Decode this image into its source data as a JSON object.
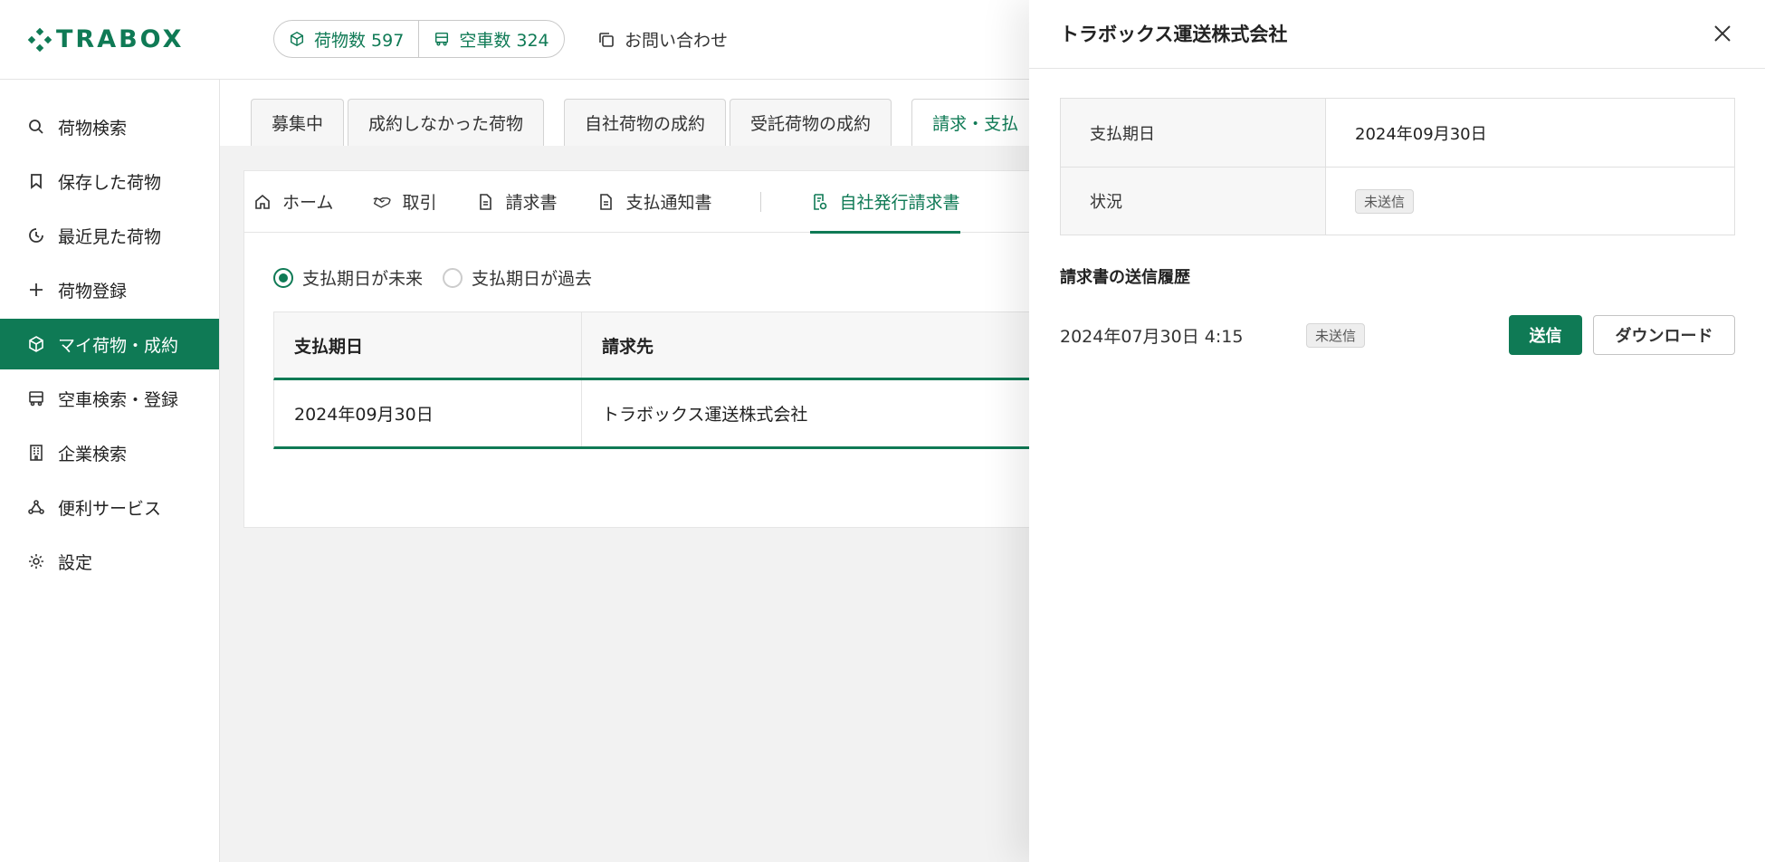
{
  "header": {
    "logo_text": "TRABOX",
    "cargo_count_label": "荷物数 597",
    "truck_count_label": "空車数 324",
    "contact_label": "お問い合わせ"
  },
  "sidebar": {
    "items": [
      {
        "label": "荷物検索",
        "icon": "search-icon"
      },
      {
        "label": "保存した荷物",
        "icon": "bookmark-icon"
      },
      {
        "label": "最近見た荷物",
        "icon": "history-icon"
      },
      {
        "label": "荷物登録",
        "icon": "plus-icon"
      },
      {
        "label": "マイ荷物・成約",
        "icon": "box-icon",
        "active": true
      },
      {
        "label": "空車検索・登録",
        "icon": "truck-icon"
      },
      {
        "label": "企業検索",
        "icon": "building-icon"
      },
      {
        "label": "便利サービス",
        "icon": "network-icon"
      },
      {
        "label": "設定",
        "icon": "gear-icon"
      }
    ]
  },
  "tabs": [
    "募集中",
    "成約しなかった荷物",
    "自社荷物の成約",
    "受託荷物の成約",
    "請求・支払"
  ],
  "subnav": [
    "ホーム",
    "取引",
    "請求書",
    "支払通知書",
    "自社発行請求書"
  ],
  "filter": {
    "future_label": "支払期日が未来",
    "past_label": "支払期日が過去"
  },
  "table": {
    "headers": [
      "支払期日",
      "請求先"
    ],
    "rows": [
      [
        "2024年09月30日",
        "トラボックス運送株式会社"
      ]
    ]
  },
  "drawer": {
    "title": "トラボックス運送株式会社",
    "due_label": "支払期日",
    "due_value": "2024年09月30日",
    "status_label": "状況",
    "status_value": "未送信",
    "history_title": "請求書の送信履歴",
    "history": [
      {
        "datetime": "2024年07月30日 4:15",
        "status": "未送信"
      }
    ],
    "send_button": "送信",
    "download_button": "ダウンロード"
  },
  "colors": {
    "accent": "#0f7a55"
  }
}
